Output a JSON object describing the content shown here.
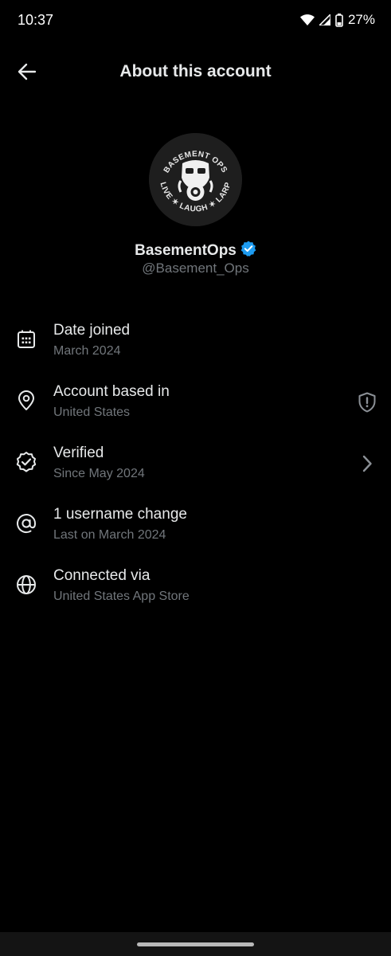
{
  "status_bar": {
    "time": "10:37",
    "battery": "27%",
    "icons": [
      "wifi-icon",
      "cell-signal-icon",
      "battery-icon"
    ]
  },
  "header": {
    "title": "About this account",
    "back_icon": "back-arrow-icon"
  },
  "profile": {
    "avatar_text_top": "BASEMENT OPS",
    "avatar_text_bottom": "LIVE ✶ LAUGH ✶ LARP",
    "name": "BasementOps",
    "handle": "@Basement_Ops",
    "verified_icon": "verified-badge-icon"
  },
  "info_rows": [
    {
      "icon": "calendar-icon",
      "title": "Date joined",
      "subtitle": "March 2024"
    },
    {
      "icon": "location-pin-icon",
      "title": "Account based in",
      "subtitle": "United States",
      "trailing": "shield-alert-icon"
    },
    {
      "icon": "verified-seal-icon",
      "title": "Verified",
      "subtitle": "Since May 2024",
      "trailing": "chevron-right-icon"
    },
    {
      "icon": "at-sign-icon",
      "title": "1 username change",
      "subtitle": "Last on March 2024"
    },
    {
      "icon": "globe-icon",
      "title": "Connected via",
      "subtitle": "United States App Store"
    }
  ],
  "colors": {
    "background": "#000000",
    "primary_text": "#e7e9ea",
    "secondary_text": "#71767b",
    "verified_blue": "#1d9bf0"
  }
}
